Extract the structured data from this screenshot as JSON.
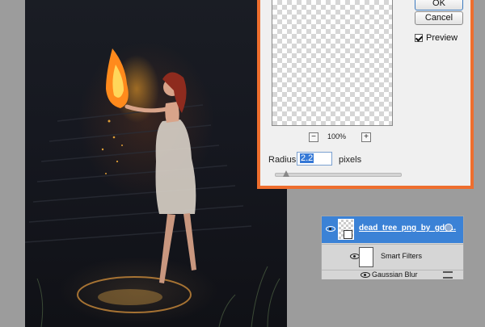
{
  "dialog": {
    "ok_label": "OK",
    "cancel_label": "Cancel",
    "preview_label": "Preview",
    "preview_checked": true,
    "zoom_out": "−",
    "zoom_in": "+",
    "zoom_level": "100%",
    "radius_label": "Radius:",
    "radius_value": "2.2",
    "radius_unit": "pixels",
    "accent_color": "#ee6e2e"
  },
  "layers": {
    "selected_layer_name": "dead_tree_png_by_gd0...",
    "smart_filters_label": "Smart Filters",
    "filter_name": "Gaussian Blur",
    "selection_color": "#3b82d6"
  }
}
